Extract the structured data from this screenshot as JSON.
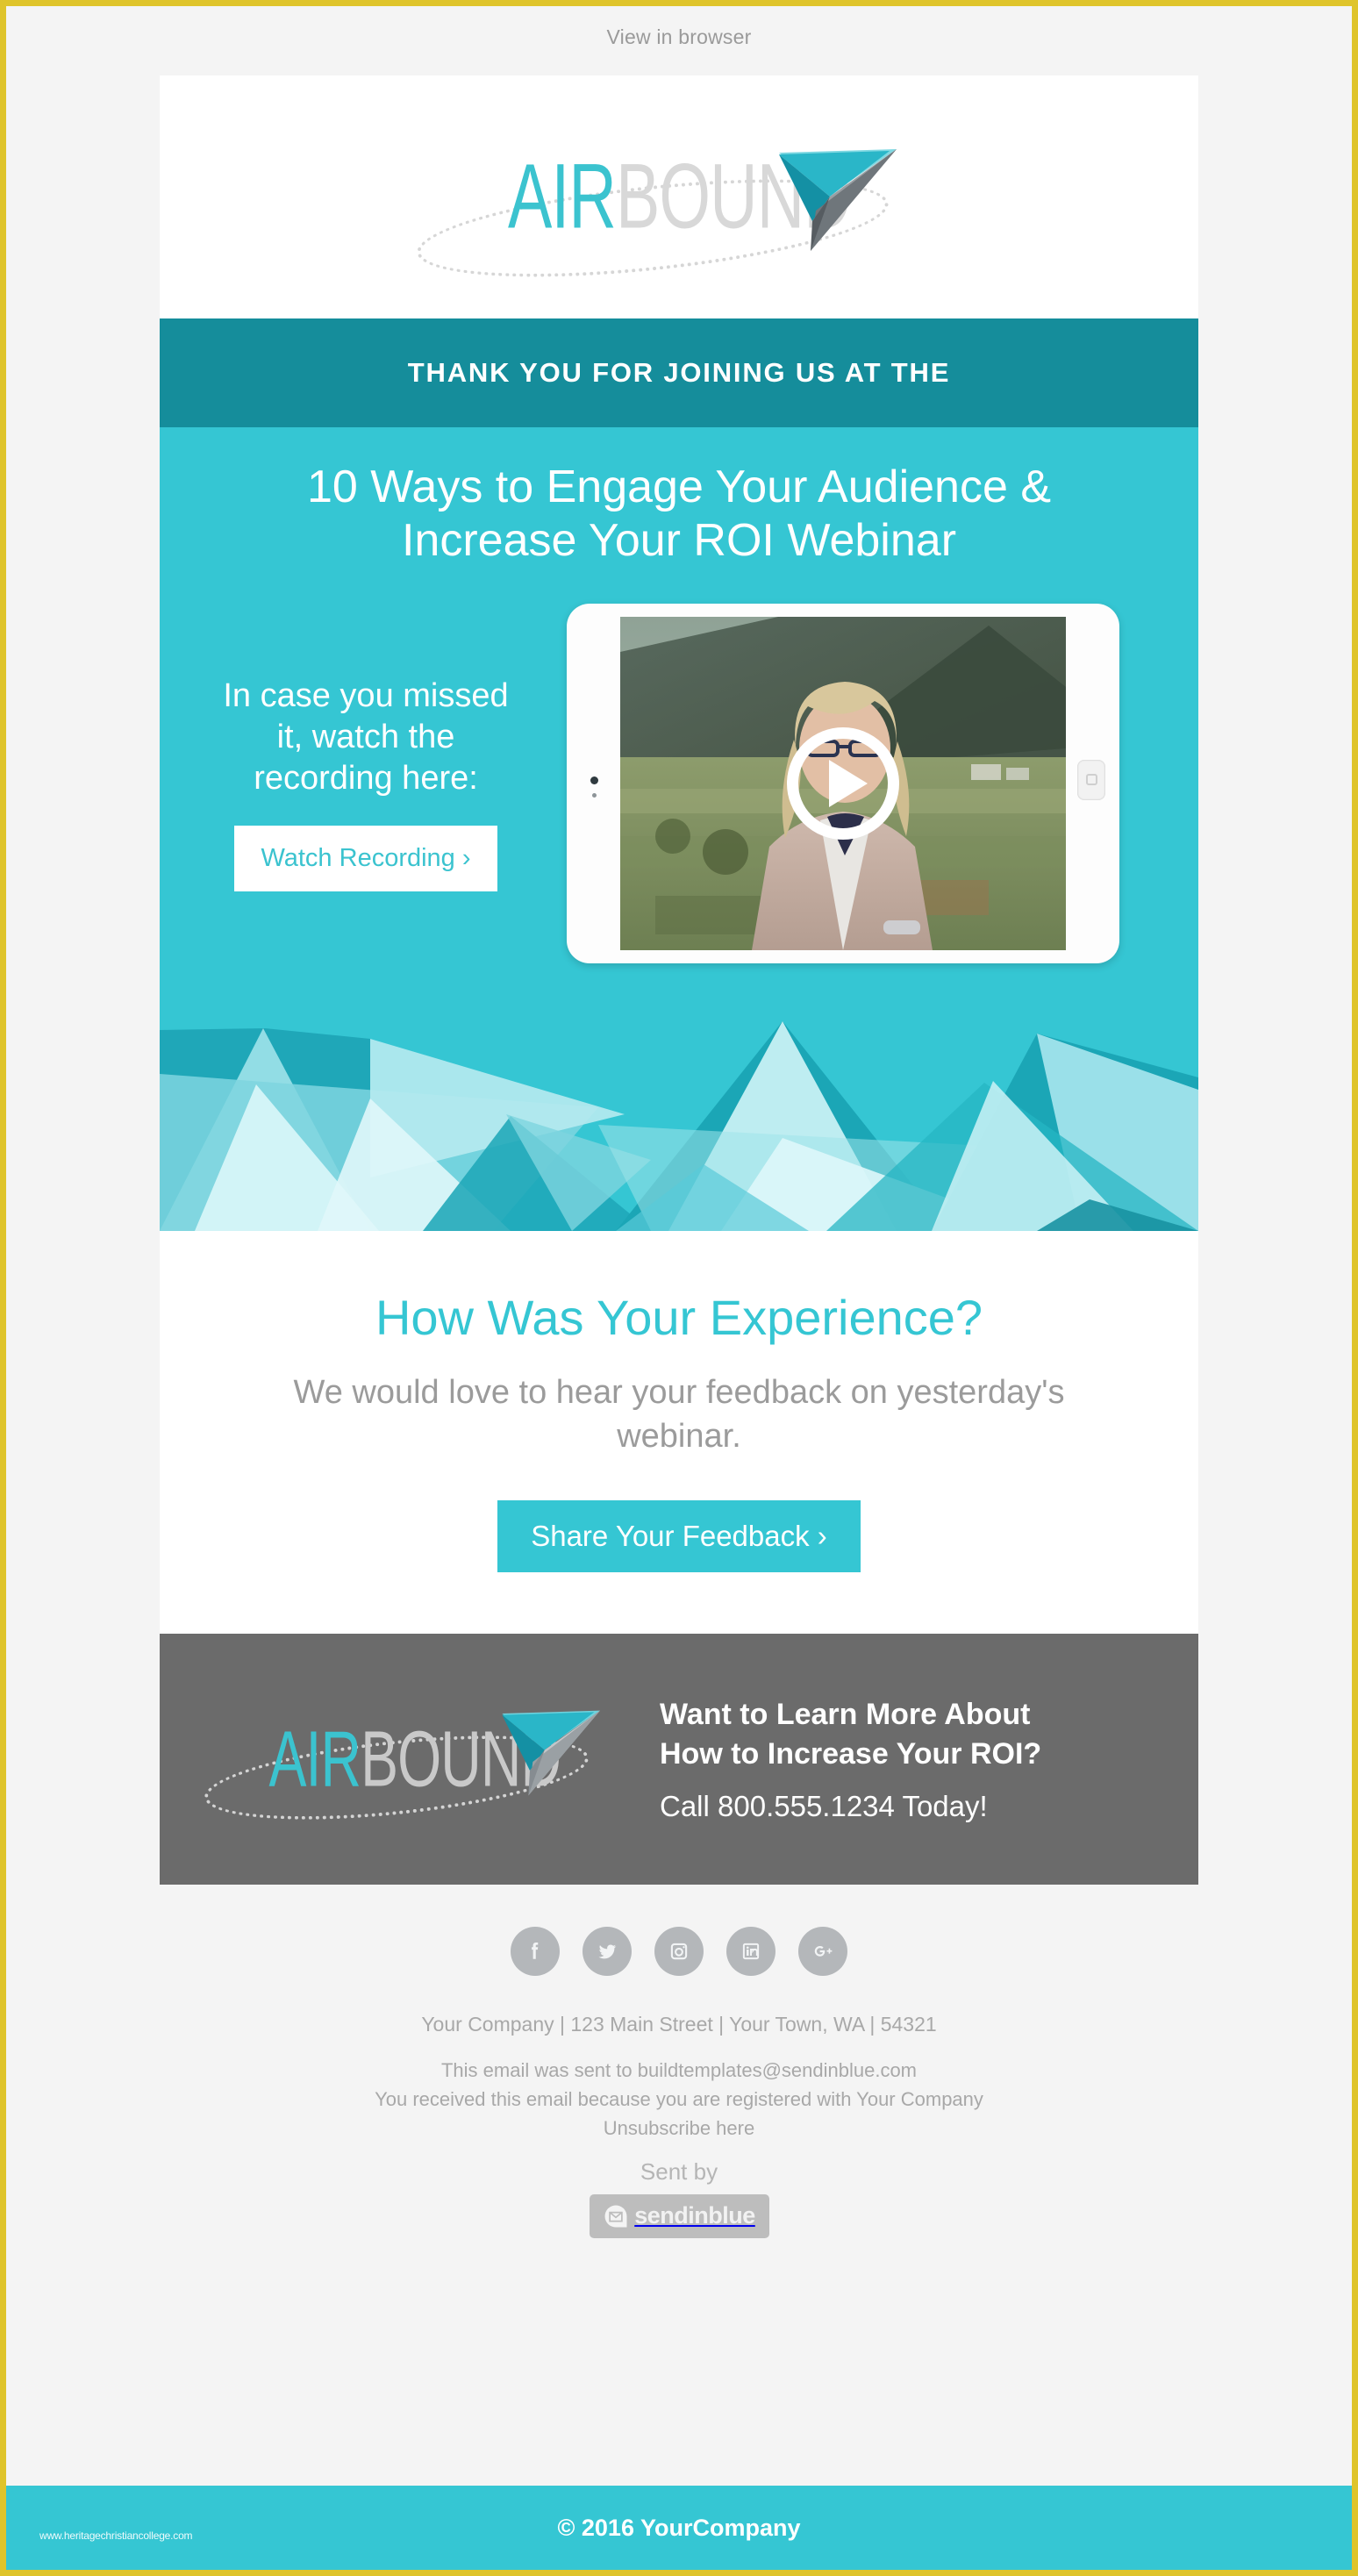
{
  "preheader": {
    "view_in_browser": "View in browser"
  },
  "brand": {
    "name_part1": "AIR",
    "name_part2": "BOUND",
    "accent_color": "#35c6d3",
    "dark_teal": "#158d9b",
    "gray": "#6b6b6b",
    "border_color": "#dfc42b"
  },
  "kicker": {
    "text": "THANK YOU FOR JOINING US AT THE"
  },
  "hero": {
    "title": "10 Ways to Engage Your Audience & Increase Your ROI Webinar",
    "left_text": "In case you missed it, watch the recording here:",
    "watch_button": "Watch Recording ›",
    "video_alt": "webinar-video-thumbnail"
  },
  "feedback": {
    "title": "How Was Your Experience?",
    "subtitle": "We would love to hear your feedback on yesterday's webinar.",
    "button": "Share Your Feedback ›"
  },
  "cta": {
    "heading_line1": "Want to Learn More About",
    "heading_line2": "How to Increase Your ROI?",
    "phone": "Call 800.555.1234 Today!"
  },
  "social": [
    {
      "name": "facebook",
      "label": "f"
    },
    {
      "name": "twitter",
      "label": "t"
    },
    {
      "name": "instagram",
      "label": "i"
    },
    {
      "name": "linkedin",
      "label": "in"
    },
    {
      "name": "googleplus",
      "label": "g+"
    }
  ],
  "footer": {
    "address": "Your Company  |  123 Main Street  |  Your Town, WA  |  54321",
    "sent_to": "This email was sent to buildtemplates@sendinblue.com",
    "registered": "You received this email because you are registered with Your Company",
    "unsubscribe": "Unsubscribe here",
    "sent_by": "Sent by",
    "provider": "sendinblue"
  },
  "bottom": {
    "copyright": "© 2016 YourCompany",
    "watermark": "www.heritagechristiancollege.com"
  }
}
